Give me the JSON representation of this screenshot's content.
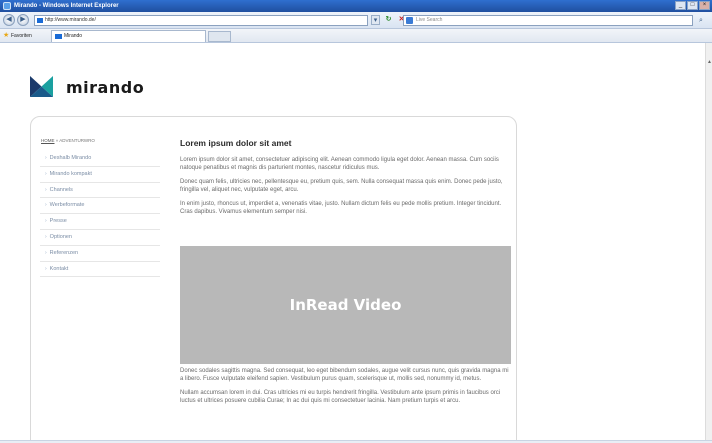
{
  "browser": {
    "window_title": "Mirando - Windows Internet Explorer",
    "url": "http://www.mirando.de/",
    "search_placeholder": "Live Search",
    "favorites_label": "Favoriten",
    "tab_title": "Mirando",
    "win_controls": [
      "_",
      "□",
      "×"
    ]
  },
  "page": {
    "logo_text": "mirando",
    "brand_colors": {
      "dark_blue": "#1b3a6b",
      "teal": "#1aa0a0"
    },
    "breadcrumb": {
      "home": "HOME",
      "separator": " » ",
      "current": "ADVENTURWRO"
    },
    "sidebar": {
      "items": [
        {
          "label": "Deshalb Mirando"
        },
        {
          "label": "Mirando kompakt"
        },
        {
          "label": "Channels"
        },
        {
          "label": "Werbeformate"
        },
        {
          "label": "Presse"
        },
        {
          "label": "Optionen"
        },
        {
          "label": "Referenzen"
        },
        {
          "label": "Kontakt"
        }
      ]
    },
    "article": {
      "title": "Lorem ipsum dolor sit amet",
      "paragraphs": [
        "Lorem ipsum dolor sit amet, consectetuer adipiscing elit. Aenean commodo ligula eget dolor. Aenean massa. Cum sociis natoque penatibus et magnis dis parturient montes, nascetur ridiculus mus.",
        "Donec quam felis, ultricies nec, pellentesque eu, pretium quis, sem. Nulla consequat massa quis enim. Donec pede justo, fringilla vel, aliquet nec, vulputate eget, arcu.",
        "In enim justo, rhoncus ut, imperdiet a, venenatis vitae, justo. Nullam dictum felis eu pede mollis pretium. Integer tincidunt. Cras dapibus. Vivamus elementum semper nisi."
      ],
      "video_label": "InRead Video",
      "paragraphs_after": [
        "Donec sodales sagittis magna. Sed consequat, leo eget bibendum sodales, augue velit cursus nunc, quis gravida magna mi a libero. Fusce vulputate eleifend sapien. Vestibulum purus quam, scelerisque ut, mollis sed, nonummy id, metus.",
        "Nullam accumsan lorem in dui. Cras ultricies mi eu turpis hendrerit fringilla. Vestibulum ante ipsum primis in faucibus orci luctus et ultrices posuere cubilia Curae; In ac dui quis mi consectetuer lacinia. Nam pretium turpis et arcu."
      ]
    }
  }
}
